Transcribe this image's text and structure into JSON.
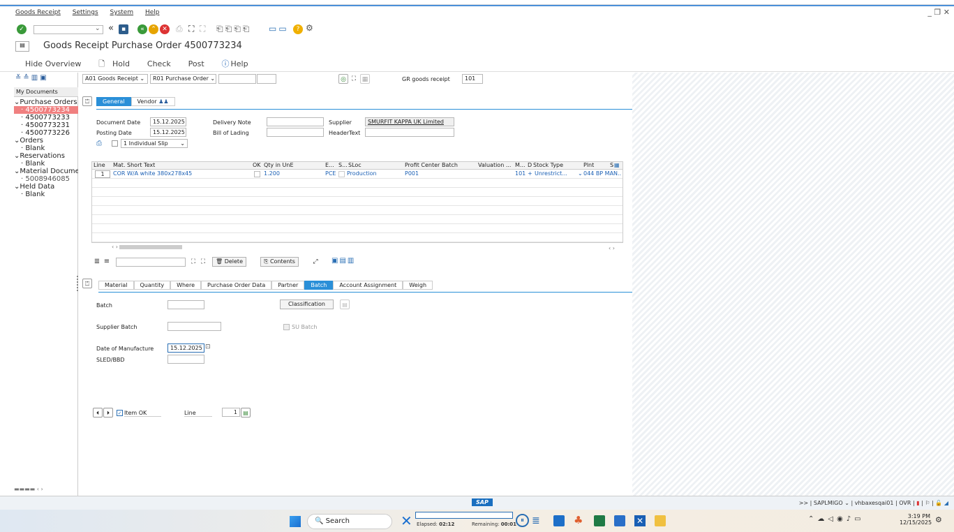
{
  "menu": {
    "items": [
      "Goods Receipt",
      "Settings",
      "System",
      "Help"
    ]
  },
  "window": {
    "title": "Goods Receipt Purchase Order 4500773234"
  },
  "app_toolbar": {
    "hide_overview": "Hide Overview",
    "hold": "Hold",
    "check": "Check",
    "post": "Post",
    "help": "Help"
  },
  "sidebar": {
    "my_documents": "My Documents",
    "purchase_orders": "Purchase Orders",
    "po_items": [
      "4500773234",
      "4500773233",
      "4500773231",
      "4500773226"
    ],
    "orders": "Orders",
    "orders_blank": "Blank",
    "reservations": "Reservations",
    "reservations_blank": "Blank",
    "material_documents": "Material Docume",
    "material_doc_item": "5008946085",
    "held_data": "Held Data",
    "held_blank": "Blank"
  },
  "selection": {
    "action": "A01 Goods Receipt",
    "ref": "R01 Purchase Order",
    "gr_label": "GR goods receipt",
    "gr_value": "101"
  },
  "header_tabs": {
    "general": "General",
    "vendor": "Vendor"
  },
  "general": {
    "document_date_label": "Document Date",
    "document_date": "15.12.2025",
    "posting_date_label": "Posting Date",
    "posting_date": "15.12.2025",
    "delivery_note_label": "Delivery Note",
    "bill_of_lading_label": "Bill of Lading",
    "supplier_label": "Supplier",
    "supplier": "SMURFIT KAPPA UK Limited",
    "header_text_label": "HeaderText",
    "slip": "1 Individual Slip"
  },
  "grid": {
    "headers": [
      "Line",
      "Mat. Short Text",
      "OK",
      "Qty in UnE",
      "E...",
      "S...",
      "SLoc",
      "Profit Center",
      "Batch",
      "Valuation ...",
      "M...",
      "D",
      "Stock Type",
      "Plnt",
      "S"
    ],
    "rows": [
      {
        "line": "1",
        "text": "COR W/A white 380x278x45",
        "qty": "1.200",
        "unit": "PCE",
        "sloc": "Production",
        "profit_center": "P001",
        "mvt": "101",
        "d": "+",
        "stock_type": "Unrestrict...",
        "plant": "044 BP MAN.."
      }
    ]
  },
  "grid_toolbar": {
    "delete": "Delete",
    "contents": "Contents"
  },
  "detail_tabs": [
    "Material",
    "Quantity",
    "Where",
    "Purchase Order Data",
    "Partner",
    "Batch",
    "Account Assignment",
    "Weigh"
  ],
  "batch": {
    "batch_label": "Batch",
    "classification": "Classification",
    "supplier_batch_label": "Supplier Batch",
    "su_batch": "SU Batch",
    "date_of_manufacture_label": "Date of Manufacture",
    "date_of_manufacture": "15.12.2025",
    "sled_label": "SLED/BBD"
  },
  "item_footer": {
    "item_ok": "Item OK",
    "line_label": "Line",
    "line_value": "1"
  },
  "status": {
    "sap": "SAP",
    "system": "SAPLMIGO",
    "server": "vhbaxesqai01",
    "mode": "OVR"
  },
  "taskbar": {
    "search": "Search",
    "elapsed_label": "Elapsed:",
    "elapsed": "02:12",
    "remaining_label": "Remaining:",
    "remaining": "00:01",
    "time": "3:19 PM",
    "date": "12/15/2025"
  },
  "colors": {
    "accent": "#2a8fd8",
    "highlight": "#f08080",
    "link": "#1a5fb4"
  }
}
